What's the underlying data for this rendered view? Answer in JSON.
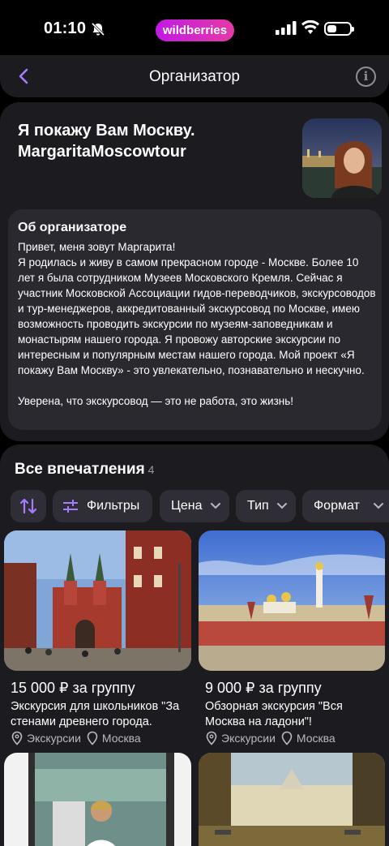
{
  "status_bar": {
    "time": "01:10",
    "brand_pill": "wildberries"
  },
  "header": {
    "title": "Организатор"
  },
  "organizer": {
    "name": "Я покажу Вам Москву. MargaritaMoscowtour",
    "about_title": "Об организаторе",
    "about_text": "Привет, меня зовут Маргарита!\nЯ родилась и живу в самом прекрасном городе - Москве. Более 10 лет я была сотрудником Музеев Московского Кремля. Сейчас я участник Московской Ассоциации гидов-переводчиков, экскурсоводов и тур-менеджеров, аккредитованный экскурсовод по Москве, имею возможность проводить экскурсии по музеям-заповедникам и монастырям нашего города. Я провожу авторские экскурсии по интересным и популярным местам нашего города. Мой проект «Я покажу Вам Москву» - это увлекательно, познавательно и нескучно.\n\nУверена, что экскурсовод — это не работа, это жизнь!"
  },
  "experiences": {
    "title": "Все впечатления",
    "count": "4",
    "filters": {
      "filters_label": "Фильтры",
      "price_label": "Цена",
      "type_label": "Тип",
      "format_label": "Формат"
    },
    "items": [
      {
        "price": "15 000 ₽ за группу",
        "name": "Экскурсия для школьников \"За стенами древнего города. Прогулка",
        "category": "Экскурсии",
        "city": "Москва"
      },
      {
        "price": "9 000 ₽ за группу",
        "name": "Обзорная экскурсия \"Вся Москва на ладони\"!",
        "category": "Экскурсии",
        "city": "Москва"
      }
    ]
  },
  "colors": {
    "accent": "#a77bff",
    "brand_gradient_start": "#c219e5",
    "brand_gradient_end": "#e53aa6",
    "card_bg": "#1c1b20"
  }
}
